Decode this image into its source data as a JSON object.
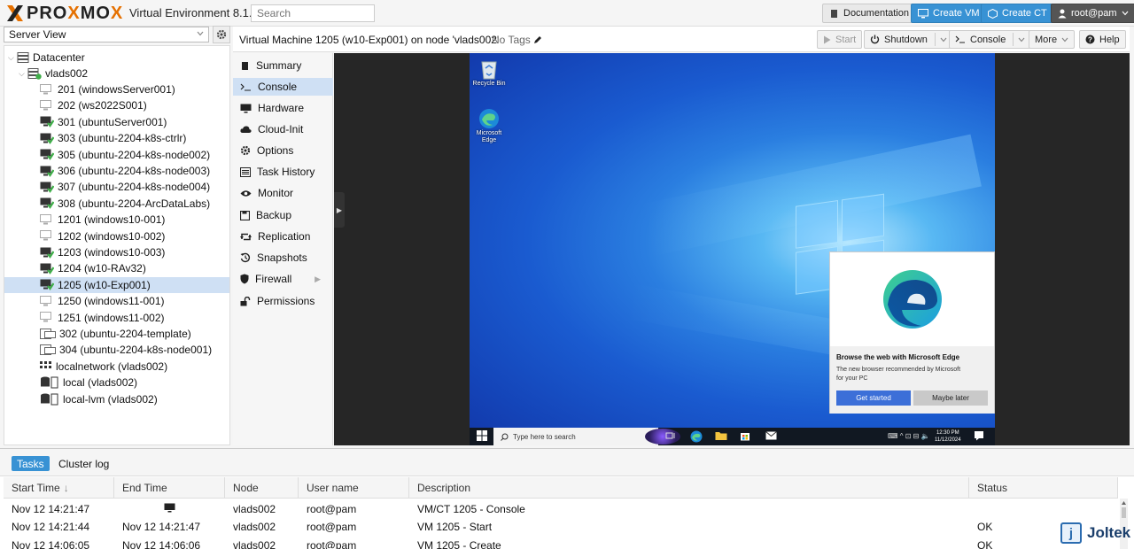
{
  "header": {
    "logo_text": "PROXMOX",
    "app_title": "Virtual Environment 8.1.4",
    "search_placeholder": "Search",
    "buttons": {
      "documentation": "Documentation",
      "create_vm": "Create VM",
      "create_ct": "Create CT",
      "user": "root@pam"
    }
  },
  "server_view": {
    "label": "Server View"
  },
  "tree": {
    "datacenter": "Datacenter",
    "node": "vlads002",
    "items": [
      {
        "label": "201 (windowsServer001)",
        "state": "stopped"
      },
      {
        "label": "202 (ws2022S001)",
        "state": "stopped"
      },
      {
        "label": "301 (ubuntuServer001)",
        "state": "running"
      },
      {
        "label": "303 (ubuntu-2204-k8s-ctrlr)",
        "state": "running"
      },
      {
        "label": "305 (ubuntu-2204-k8s-node002)",
        "state": "running"
      },
      {
        "label": "306 (ubuntu-2204-k8s-node003)",
        "state": "running"
      },
      {
        "label": "307 (ubuntu-2204-k8s-node004)",
        "state": "running"
      },
      {
        "label": "308 (ubuntu-2204-ArcDataLabs)",
        "state": "running"
      },
      {
        "label": "1201 (windows10-001)",
        "state": "stopped"
      },
      {
        "label": "1202 (windows10-002)",
        "state": "stopped"
      },
      {
        "label": "1203 (windows10-003)",
        "state": "running"
      },
      {
        "label": "1204 (w10-RAv32)",
        "state": "running"
      },
      {
        "label": "1205 (w10-Exp001)",
        "state": "running"
      },
      {
        "label": "1250 (windows11-001)",
        "state": "stopped"
      },
      {
        "label": "1251 (windows11-002)",
        "state": "stopped"
      },
      {
        "label": "302 (ubuntu-2204-template)",
        "state": "template"
      },
      {
        "label": "304 (ubuntu-2204-k8s-node001)",
        "state": "template"
      },
      {
        "label": "localnetwork (vlads002)",
        "state": "network"
      },
      {
        "label": "local (vlads002)",
        "state": "storage"
      },
      {
        "label": "local-lvm (vlads002)",
        "state": "storage"
      }
    ],
    "selected": "1205 (w10-Exp001)"
  },
  "content": {
    "title": "Virtual Machine 1205 (w10-Exp001) on node 'vlads002'",
    "tags": "No Tags",
    "buttons": {
      "start": "Start",
      "shutdown": "Shutdown",
      "console": "Console",
      "more": "More",
      "help": "Help"
    }
  },
  "vm_menu": {
    "items": [
      {
        "label": "Summary",
        "icon": "book-icon"
      },
      {
        "label": "Console",
        "icon": "terminal-icon"
      },
      {
        "label": "Hardware",
        "icon": "desktop-icon"
      },
      {
        "label": "Cloud-Init",
        "icon": "cloud-icon"
      },
      {
        "label": "Options",
        "icon": "gear-icon"
      },
      {
        "label": "Task History",
        "icon": "list-icon"
      },
      {
        "label": "Monitor",
        "icon": "eye-icon"
      },
      {
        "label": "Backup",
        "icon": "floppy-icon"
      },
      {
        "label": "Replication",
        "icon": "retweet-icon"
      },
      {
        "label": "Snapshots",
        "icon": "history-icon"
      },
      {
        "label": "Firewall",
        "icon": "shield-icon"
      },
      {
        "label": "Permissions",
        "icon": "unlock-icon"
      }
    ],
    "selected": "Console"
  },
  "guest": {
    "desktop_icons": [
      {
        "label": "Recycle Bin"
      },
      {
        "label": "Microsoft Edge"
      }
    ],
    "edge_popup": {
      "title": "Browse the web with Microsoft Edge",
      "description": "The new browser recommended by Microsoft for your PC",
      "primary": "Get started",
      "secondary": "Maybe later"
    },
    "taskbar": {
      "search_placeholder": "Type here to search",
      "time": "12:30 PM",
      "date": "11/12/2024"
    }
  },
  "tasks_panel": {
    "tabs": [
      "Tasks",
      "Cluster log"
    ],
    "columns": [
      "Start Time",
      "End Time",
      "Node",
      "User name",
      "Description",
      "Status"
    ],
    "rows": [
      {
        "start": "Nov 12 14:21:47",
        "end": "",
        "node": "vlads002",
        "user": "root@pam",
        "desc": "VM/CT 1205 - Console",
        "status": ""
      },
      {
        "start": "Nov 12 14:21:44",
        "end": "Nov 12 14:21:47",
        "node": "vlads002",
        "user": "root@pam",
        "desc": "VM 1205 - Start",
        "status": "OK"
      },
      {
        "start": "Nov 12 14:06:05",
        "end": "Nov 12 14:06:06",
        "node": "vlads002",
        "user": "root@pam",
        "desc": "VM 1205 - Create",
        "status": "OK"
      }
    ]
  },
  "watermark": {
    "text": "Joltek",
    "badge": "j"
  },
  "colors": {
    "accent": "#3892d4",
    "logo_orange": "#e57000",
    "selection": "#cfe0f4"
  }
}
